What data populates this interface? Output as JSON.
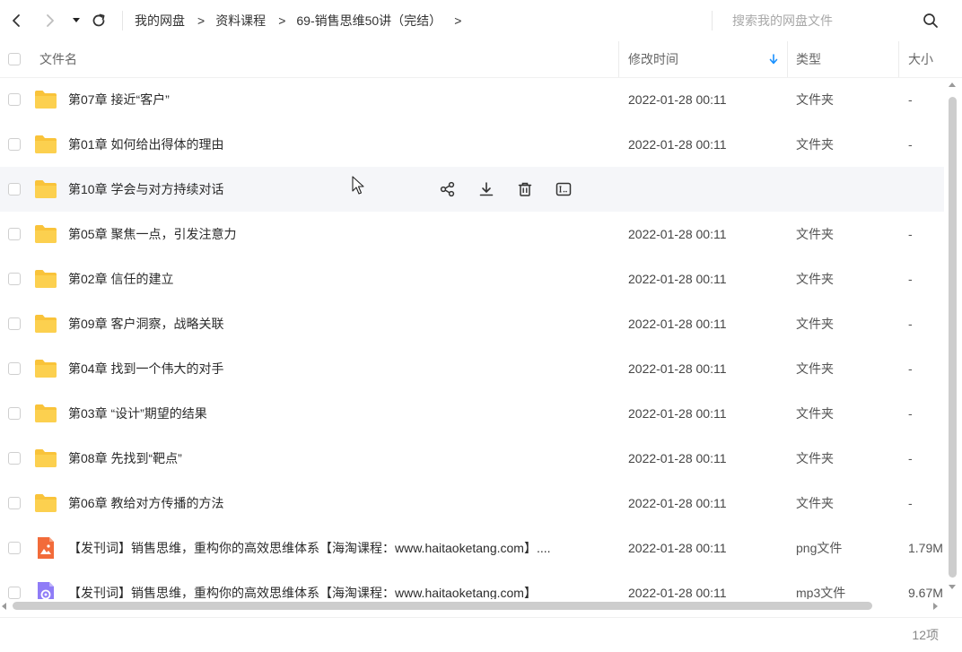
{
  "search": {
    "placeholder": "搜索我的网盘文件"
  },
  "breadcrumb": [
    "我的网盘",
    "资料课程",
    "69-销售思维50讲（完结）"
  ],
  "columns": {
    "name": "文件名",
    "modified": "修改时间",
    "type": "类型",
    "size": "大小"
  },
  "rows": [
    {
      "name": "第07章 接近“客户”",
      "date": "2022-01-28 00:11",
      "type": "文件夹",
      "size": "-",
      "icon": "folder-icon"
    },
    {
      "name": "第01章 如何给出得体的理由",
      "date": "2022-01-28 00:11",
      "type": "文件夹",
      "size": "-",
      "icon": "folder-icon"
    },
    {
      "name": "第10章 学会与对方持续对话",
      "date": "",
      "type": "",
      "size": "",
      "icon": "folder-icon"
    },
    {
      "name": "第05章 聚焦一点，引发注意力",
      "date": "2022-01-28 00:11",
      "type": "文件夹",
      "size": "-",
      "icon": "folder-icon"
    },
    {
      "name": "第02章 信任的建立",
      "date": "2022-01-28 00:11",
      "type": "文件夹",
      "size": "-",
      "icon": "folder-icon"
    },
    {
      "name": "第09章 客户洞察，战略关联",
      "date": "2022-01-28 00:11",
      "type": "文件夹",
      "size": "-",
      "icon": "folder-icon"
    },
    {
      "name": "第04章 找到一个伟大的对手",
      "date": "2022-01-28 00:11",
      "type": "文件夹",
      "size": "-",
      "icon": "folder-icon"
    },
    {
      "name": "第03章 “设计”期望的结果",
      "date": "2022-01-28 00:11",
      "type": "文件夹",
      "size": "-",
      "icon": "folder-icon"
    },
    {
      "name": "第08章 先找到“靶点”",
      "date": "2022-01-28 00:11",
      "type": "文件夹",
      "size": "-",
      "icon": "folder-icon"
    },
    {
      "name": "第06章 教给对方传播的方法",
      "date": "2022-01-28 00:11",
      "type": "文件夹",
      "size": "-",
      "icon": "folder-icon"
    },
    {
      "name": "【发刊词】销售思维，重构你的高效思维体系【海淘课程：www.haitaoketang.com】....",
      "date": "2022-01-28 00:11",
      "type": "png文件",
      "size": "1.79M",
      "icon": "image-file-icon"
    },
    {
      "name": "【发刊词】销售思维，重构你的高效思维体系【海淘课程：www.haitaoketang.com】",
      "date": "2022-01-28 00:11",
      "type": "mp3文件",
      "size": "9.67M",
      "icon": "audio-file-icon"
    }
  ],
  "status": {
    "count": "12项"
  },
  "colors": {
    "folder": "#f9c33a",
    "accent": "#1890ff",
    "hover_row": "#f5f6f9",
    "image_file": "#f26b3a",
    "audio_file": "#8f7cf7"
  }
}
